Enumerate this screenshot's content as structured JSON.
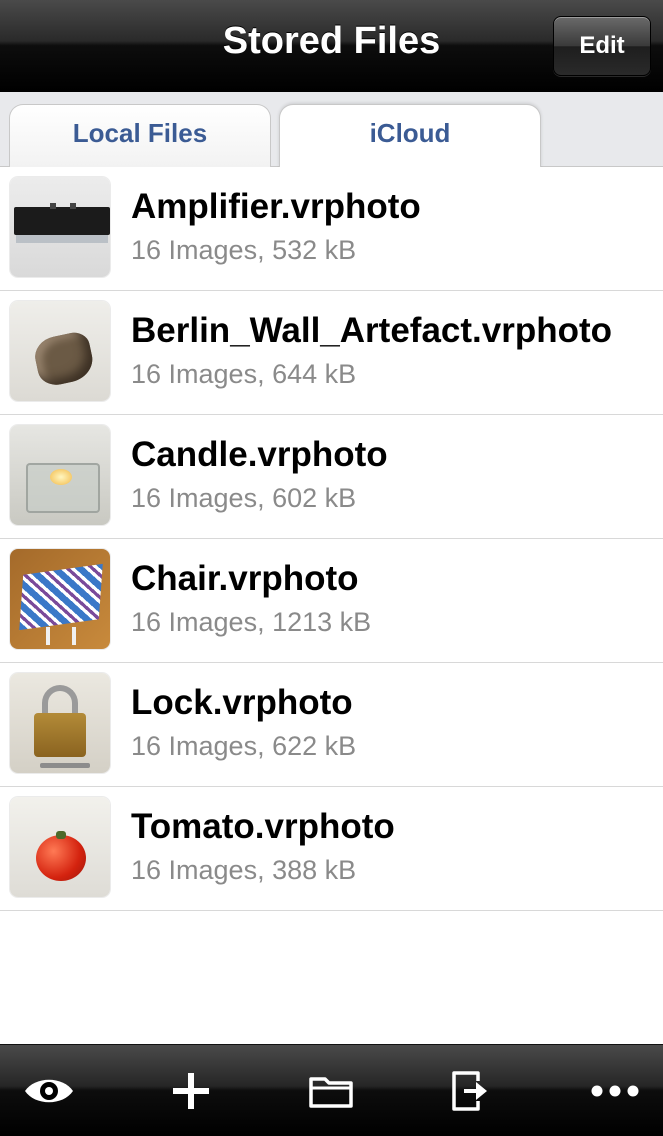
{
  "navbar": {
    "title": "Stored Files",
    "edit_label": "Edit"
  },
  "tabs": {
    "local_label": "Local Files",
    "icloud_label": "iCloud",
    "selected": "iCloud"
  },
  "files": [
    {
      "name": "Amplifier.vrphoto",
      "info": "16 Images, 532 kB",
      "thumb": "amplifier"
    },
    {
      "name": "Berlin_Wall_Artefact.vrphoto",
      "info": "16 Images, 644 kB",
      "thumb": "berlin-wall-artefact"
    },
    {
      "name": "Candle.vrphoto",
      "info": "16 Images, 602 kB",
      "thumb": "candle"
    },
    {
      "name": "Chair.vrphoto",
      "info": "16 Images, 1213 kB",
      "thumb": "chair"
    },
    {
      "name": "Lock.vrphoto",
      "info": "16 Images, 622 kB",
      "thumb": "lock"
    },
    {
      "name": "Tomato.vrphoto",
      "info": "16 Images, 388 kB",
      "thumb": "tomato"
    }
  ],
  "toolbar": {
    "icons": [
      "eye-icon",
      "plus-icon",
      "folder-icon",
      "export-icon",
      "more-icon"
    ]
  },
  "colors": {
    "tab_text": "#3b5b94",
    "info_text": "#8a8a8a",
    "bar_bg": "#000000"
  }
}
